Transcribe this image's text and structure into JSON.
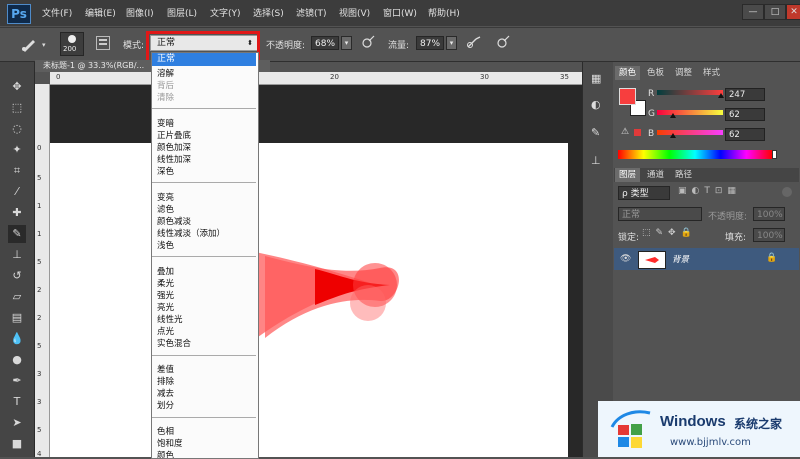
{
  "app": {
    "logo": "Ps",
    "menus": [
      "文件(F)",
      "编辑(E)",
      "图像(I)",
      "图层(L)",
      "文字(Y)",
      "选择(S)",
      "滤镜(T)",
      "视图(V)",
      "窗口(W)",
      "帮助(H)"
    ],
    "window_buttons": [
      "—",
      "□",
      "✕"
    ]
  },
  "options_bar": {
    "brush_size": "200",
    "mode_label": "模式:",
    "mode_value": "正常",
    "opacity_label": "不透明度:",
    "opacity_value": "68%",
    "flow_label": "流量:",
    "flow_value": "87%"
  },
  "document": {
    "tab_title": "未标题-1 @ 33.3%(RGB/..."
  },
  "rulers": {
    "h_ticks": [
      "0",
      "10",
      "20",
      "30",
      "35"
    ],
    "v_ticks": [
      "0",
      "5",
      "1",
      "1",
      "5",
      "2",
      "2",
      "5",
      "3",
      "3",
      "5",
      "4"
    ]
  },
  "blend_modes": {
    "selected": "正常",
    "groups": [
      [
        {
          "label": "溶解",
          "dim": false
        },
        {
          "label": "背后",
          "dim": true
        },
        {
          "label": "清除",
          "dim": true
        }
      ],
      [
        {
          "label": "变暗",
          "dim": false
        },
        {
          "label": "正片叠底",
          "dim": false
        },
        {
          "label": "颜色加深",
          "dim": false
        },
        {
          "label": "线性加深",
          "dim": false
        },
        {
          "label": "深色",
          "dim": false
        }
      ],
      [
        {
          "label": "变亮",
          "dim": false
        },
        {
          "label": "滤色",
          "dim": false
        },
        {
          "label": "颜色减淡",
          "dim": false
        },
        {
          "label": "线性减淡（添加）",
          "dim": false
        },
        {
          "label": "浅色",
          "dim": false
        }
      ],
      [
        {
          "label": "叠加",
          "dim": false
        },
        {
          "label": "柔光",
          "dim": false
        },
        {
          "label": "强光",
          "dim": false
        },
        {
          "label": "亮光",
          "dim": false
        },
        {
          "label": "线性光",
          "dim": false
        },
        {
          "label": "点光",
          "dim": false
        },
        {
          "label": "实色混合",
          "dim": false
        }
      ],
      [
        {
          "label": "差值",
          "dim": false
        },
        {
          "label": "排除",
          "dim": false
        },
        {
          "label": "减去",
          "dim": false
        },
        {
          "label": "划分",
          "dim": false
        }
      ],
      [
        {
          "label": "色相",
          "dim": false
        },
        {
          "label": "饱和度",
          "dim": false
        },
        {
          "label": "颜色",
          "dim": false
        }
      ]
    ]
  },
  "color_panel": {
    "tabs": [
      "颜色",
      "色板",
      "调整",
      "样式"
    ],
    "channels": [
      {
        "label": "R",
        "value": "247",
        "knob": 0.969
      },
      {
        "label": "G",
        "value": "62",
        "knob": 0.243
      },
      {
        "label": "B",
        "value": "62",
        "knob": 0.243
      }
    ],
    "foreground": "#f73e3e",
    "background": "#ffffff"
  },
  "layers_panel": {
    "tabs": [
      "图层",
      "通道",
      "路径"
    ],
    "filter": "ρ 类型",
    "blend": "正常",
    "opacity_label": "不透明度:",
    "opacity_value": "100%",
    "lock_label": "锁定:",
    "fill_label": "填充:",
    "fill_value": "100%",
    "layer_name": "背景"
  },
  "watermark": {
    "brand": "Windows",
    "brand_cn": "系统之家",
    "url": "www.bjjmlv.com"
  },
  "colors": {
    "accent": "#2f7fe0",
    "highlight": "#e01818",
    "brush": "#ff0000"
  }
}
